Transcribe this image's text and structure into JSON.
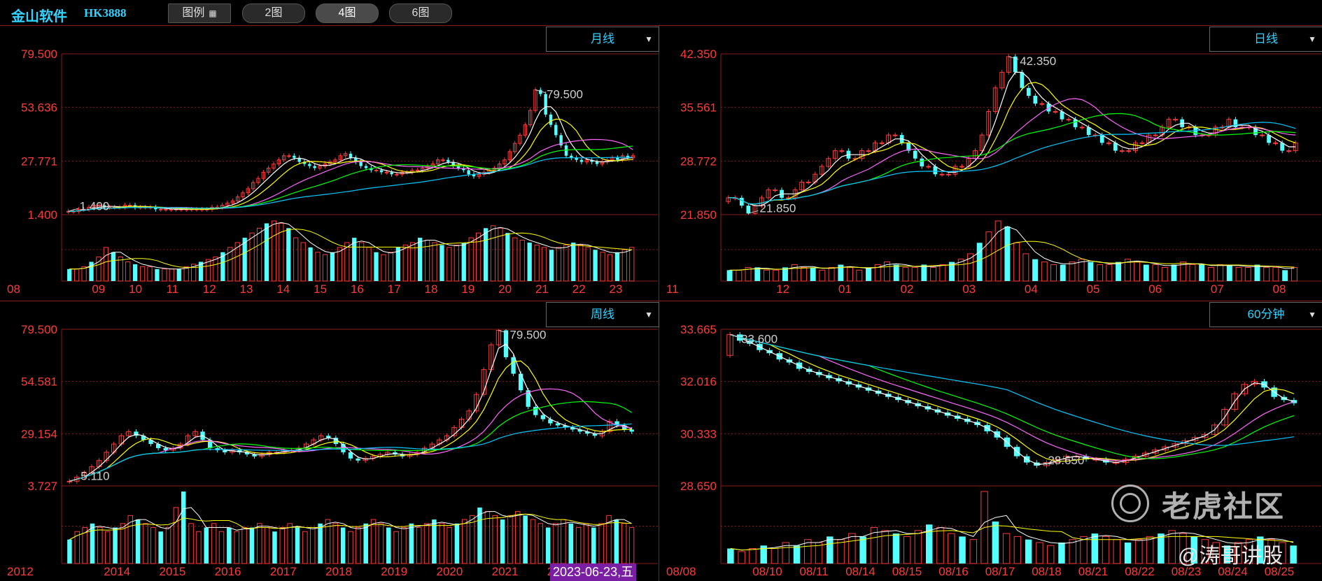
{
  "header": {
    "name": "金山软件",
    "code": "HK3888",
    "legend_button": "图例",
    "layout_buttons": [
      "2图",
      "4图",
      "6图"
    ],
    "active_layout": "4图"
  },
  "colors": {
    "up": "#ff3a3a",
    "down": "#54ffff",
    "grid": "#8b1a1a",
    "axis_label": "#ff3a3a",
    "ma_colors": [
      "#ffffff",
      "#ffff00",
      "#ff66ff",
      "#00ff00",
      "#00c8ff"
    ],
    "annotation": "#cfcfcf"
  },
  "watermark": "老虎社区",
  "signature": "@涛哥讲股",
  "chart_data": [
    {
      "type": "candlestick",
      "period": "月线",
      "ylim": [
        1.4,
        79.5
      ],
      "y_ticks": [
        "79.500",
        "53.636",
        "27.771",
        "1.400"
      ],
      "x_ticks": [
        "08",
        "09",
        "10",
        "11",
        "12",
        "13",
        "14",
        "15",
        "16",
        "17",
        "18",
        "19",
        "20",
        "21",
        "22",
        "23"
      ],
      "high_annotation": "79.500",
      "low_annotation": "1.400",
      "series": [
        {
          "name": "price",
          "values": [
            3,
            3,
            4,
            4,
            5,
            6,
            6,
            5,
            5,
            5,
            5,
            6,
            6,
            5,
            5,
            5,
            5,
            4,
            4,
            4,
            4,
            4,
            4,
            4,
            4,
            4,
            4,
            4,
            5,
            5,
            6,
            7,
            8,
            10,
            12,
            14,
            17,
            19,
            22,
            24,
            26,
            28,
            30,
            30,
            29,
            27,
            26,
            25,
            24,
            25,
            26,
            27,
            28,
            30,
            31,
            29,
            27,
            25,
            24,
            23,
            23,
            22,
            22,
            21,
            21,
            22,
            22,
            23,
            23,
            24,
            25,
            26,
            28,
            28,
            27,
            25,
            24,
            23,
            21,
            20,
            21,
            22,
            23,
            24,
            26,
            28,
            32,
            36,
            40,
            45,
            52,
            62,
            60,
            50,
            45,
            40,
            35,
            30,
            29,
            28,
            27,
            28,
            27,
            26,
            27,
            28,
            29,
            28,
            30,
            29,
            30
          ]
        }
      ],
      "volume": [
        5,
        5,
        6,
        8,
        10,
        14,
        12,
        10,
        8,
        7,
        6,
        6,
        5,
        5,
        5,
        5,
        6,
        7,
        8,
        9,
        10,
        12,
        14,
        16,
        18,
        20,
        22,
        24,
        25,
        24,
        22,
        18,
        16,
        14,
        12,
        11,
        12,
        14,
        16,
        18,
        16,
        14,
        12,
        11,
        12,
        14,
        15,
        16,
        18,
        17,
        16,
        15,
        14,
        15,
        16,
        18,
        20,
        22,
        23,
        22,
        20,
        18,
        17,
        16,
        15,
        14,
        13,
        14,
        15,
        16,
        15,
        14,
        13,
        12,
        11,
        12,
        13,
        14
      ]
    },
    {
      "type": "candlestick",
      "period": "日线",
      "ylim": [
        21.85,
        42.35
      ],
      "y_ticks": [
        "42.350",
        "35.561",
        "28.772",
        "21.850"
      ],
      "x_ticks": [
        "11",
        "12",
        "01",
        "02",
        "03",
        "04",
        "05",
        "06",
        "07",
        "08"
      ],
      "high_annotation": "42.350",
      "low_annotation": "21.850",
      "series": [
        {
          "name": "price",
          "values": [
            24,
            24,
            23,
            22,
            23,
            24,
            25,
            25,
            24,
            24,
            25,
            26,
            26,
            27,
            28,
            29,
            30,
            30,
            29,
            29,
            30,
            30,
            31,
            31,
            32,
            32,
            31,
            30,
            29,
            28,
            28,
            27,
            27,
            27,
            28,
            28,
            29,
            30,
            32,
            35,
            38,
            40,
            42,
            40,
            38,
            37,
            36,
            36,
            35,
            35,
            34,
            34,
            33,
            33,
            32,
            32,
            31,
            31,
            30,
            30,
            30,
            31,
            31,
            32,
            32,
            33,
            34,
            34,
            33,
            33,
            32,
            32,
            32,
            33,
            33,
            34,
            33,
            33,
            33,
            32,
            32,
            31,
            31,
            30,
            30,
            31
          ]
        }
      ],
      "volume": [
        4,
        4,
        5,
        5,
        4,
        4,
        5,
        6,
        5,
        5,
        4,
        5,
        6,
        5,
        4,
        5,
        6,
        7,
        6,
        5,
        5,
        6,
        5,
        6,
        7,
        8,
        10,
        14,
        18,
        22,
        20,
        14,
        10,
        8,
        7,
        6,
        6,
        7,
        8,
        7,
        6,
        6,
        7,
        8,
        7,
        6,
        6,
        5,
        6,
        7,
        6,
        6,
        5,
        6,
        6,
        5,
        5,
        6,
        5,
        5,
        4,
        5
      ]
    },
    {
      "type": "candlestick",
      "period": "周线",
      "ylim": [
        3.727,
        79.5
      ],
      "y_ticks": [
        "79.500",
        "54.581",
        "29.154",
        "3.727"
      ],
      "x_ticks": [
        "2012",
        "2014",
        "2015",
        "2016",
        "2017",
        "2018",
        "2019",
        "2020",
        "2021",
        "2022",
        "2023"
      ],
      "high_annotation": "79.500",
      "low_annotation": "5.110",
      "cursor_date": "2023-06-23,五",
      "series": [
        {
          "name": "price",
          "values": [
            6,
            8,
            10,
            13,
            16,
            20,
            24,
            28,
            30,
            28,
            26,
            24,
            22,
            21,
            22,
            24,
            28,
            30,
            26,
            22,
            21,
            20,
            21,
            20,
            19,
            18,
            19,
            20,
            20,
            21,
            21,
            22,
            24,
            26,
            28,
            27,
            24,
            20,
            17,
            16,
            17,
            18,
            19,
            20,
            19,
            18,
            19,
            20,
            22,
            24,
            26,
            28,
            32,
            36,
            40,
            48,
            60,
            72,
            79,
            66,
            58,
            50,
            42,
            38,
            36,
            34,
            33,
            32,
            31,
            30,
            29,
            28,
            30,
            35,
            33,
            31,
            30
          ]
        }
      ],
      "volume": [
        6,
        8,
        9,
        10,
        9,
        8,
        9,
        10,
        12,
        11,
        10,
        9,
        8,
        9,
        14,
        18,
        10,
        8,
        9,
        10,
        8,
        9,
        8,
        9,
        9,
        10,
        9,
        8,
        9,
        10,
        9,
        8,
        9,
        10,
        11,
        10,
        9,
        8,
        9,
        10,
        11,
        10,
        9,
        8,
        9,
        10,
        9,
        10,
        11,
        10,
        9,
        10,
        11,
        12,
        14,
        13,
        12,
        11,
        12,
        13,
        12,
        11,
        10,
        9,
        10,
        11,
        10,
        9,
        10,
        9,
        10,
        12,
        11,
        10,
        9
      ]
    },
    {
      "type": "candlestick",
      "period": "60分钟",
      "ylim": [
        28.65,
        33.665
      ],
      "y_ticks": [
        "33.665",
        "32.016",
        "30.333",
        "28.650"
      ],
      "x_ticks": [
        "08/08",
        "08/10",
        "08/11",
        "08/14",
        "08/15",
        "08/16",
        "08/17",
        "08/18",
        "08/21",
        "08/22",
        "08/23",
        "08/24",
        "08/25"
      ],
      "high_annotation": "33.600",
      "low_annotation": "28.650",
      "series": [
        {
          "name": "price",
          "values": [
            33.5,
            33.3,
            33.2,
            33.0,
            32.9,
            32.7,
            32.6,
            32.4,
            32.3,
            32.2,
            32.1,
            32.0,
            31.9,
            31.8,
            31.7,
            31.6,
            31.5,
            31.4,
            31.3,
            31.2,
            31.1,
            31.0,
            30.9,
            30.8,
            30.7,
            30.6,
            30.4,
            30.2,
            29.9,
            29.6,
            29.4,
            29.3,
            29.4,
            29.5,
            29.6,
            29.6,
            29.5,
            29.5,
            29.4,
            29.4,
            29.5,
            29.6,
            29.7,
            29.8,
            29.9,
            30.0,
            30.1,
            30.2,
            30.3,
            30.6,
            31.1,
            31.6,
            31.9,
            32.0,
            31.8,
            31.5,
            31.4,
            31.3
          ]
        }
      ],
      "volume": [
        5,
        4,
        5,
        6,
        5,
        7,
        6,
        8,
        7,
        9,
        8,
        10,
        9,
        12,
        11,
        10,
        9,
        11,
        13,
        12,
        10,
        9,
        8,
        24,
        14,
        10,
        9,
        8,
        7,
        6,
        7,
        8,
        9,
        10,
        9,
        8,
        7,
        8,
        9,
        10,
        11,
        10,
        9,
        8,
        7,
        6,
        7,
        8,
        9,
        8,
        7,
        6
      ]
    }
  ]
}
